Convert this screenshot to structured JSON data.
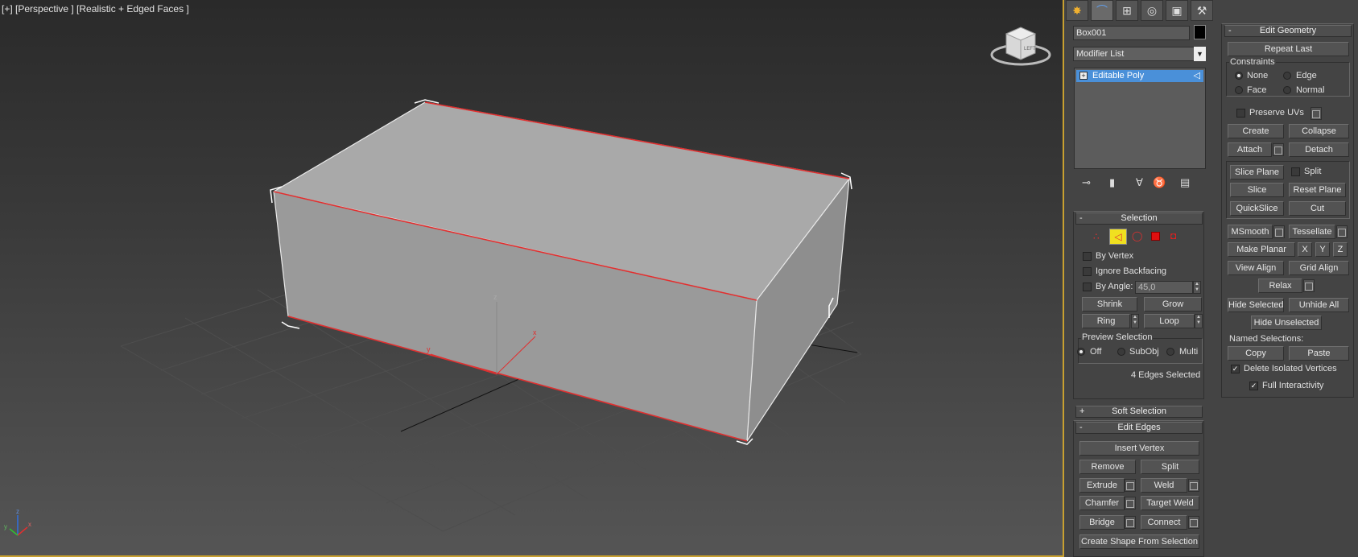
{
  "viewport": {
    "label": "[+] [Perspective ] [Realistic + Edged Faces ]",
    "axis_x": "x",
    "axis_y": "y",
    "axis_z": "z",
    "viewcube_label": "LEFT"
  },
  "tabs": [
    "create-icon",
    "modify-icon",
    "hierarchy-icon",
    "motion-icon",
    "display-icon",
    "utilities-icon"
  ],
  "object": {
    "name": "Box001",
    "color": "#000000"
  },
  "modifier_list": {
    "label": "Modifier List"
  },
  "stack": {
    "items": [
      "Editable Poly"
    ]
  },
  "selection": {
    "title": "Selection",
    "by_vertex": "By Vertex",
    "ignore_backfacing": "Ignore Backfacing",
    "by_angle": "By Angle:",
    "angle_value": "45,0",
    "shrink": "Shrink",
    "grow": "Grow",
    "ring": "Ring",
    "loop": "Loop",
    "preview_title": "Preview Selection",
    "off": "Off",
    "subobj": "SubObj",
    "multi": "Multi",
    "status": "4 Edges Selected"
  },
  "soft_selection": {
    "title": "Soft Selection"
  },
  "edit_edges": {
    "title": "Edit Edges",
    "insert_vertex": "Insert Vertex",
    "remove": "Remove",
    "split": "Split",
    "extrude": "Extrude",
    "weld": "Weld",
    "chamfer": "Chamfer",
    "target_weld": "Target Weld",
    "bridge": "Bridge",
    "connect": "Connect",
    "create_shape": "Create Shape From Selection"
  },
  "edit_geometry": {
    "title": "Edit Geometry",
    "repeat_last": "Repeat Last",
    "constraints": "Constraints",
    "none": "None",
    "edge": "Edge",
    "face": "Face",
    "normal": "Normal",
    "preserve_uvs": "Preserve UVs",
    "create": "Create",
    "collapse": "Collapse",
    "attach": "Attach",
    "detach": "Detach",
    "slice_plane": "Slice Plane",
    "split": "Split",
    "slice": "Slice",
    "reset_plane": "Reset Plane",
    "quickslice": "QuickSlice",
    "cut": "Cut",
    "msmooth": "MSmooth",
    "tessellate": "Tessellate",
    "make_planar": "Make Planar",
    "x": "X",
    "y": "Y",
    "z": "Z",
    "view_align": "View Align",
    "grid_align": "Grid Align",
    "relax": "Relax",
    "hide_selected": "Hide Selected",
    "unhide_all": "Unhide All",
    "hide_unselected": "Hide Unselected",
    "named_selections": "Named Selections:",
    "copy": "Copy",
    "paste": "Paste",
    "delete_isolated": "Delete Isolated Vertices",
    "full_interactivity": "Full Interactivity"
  }
}
